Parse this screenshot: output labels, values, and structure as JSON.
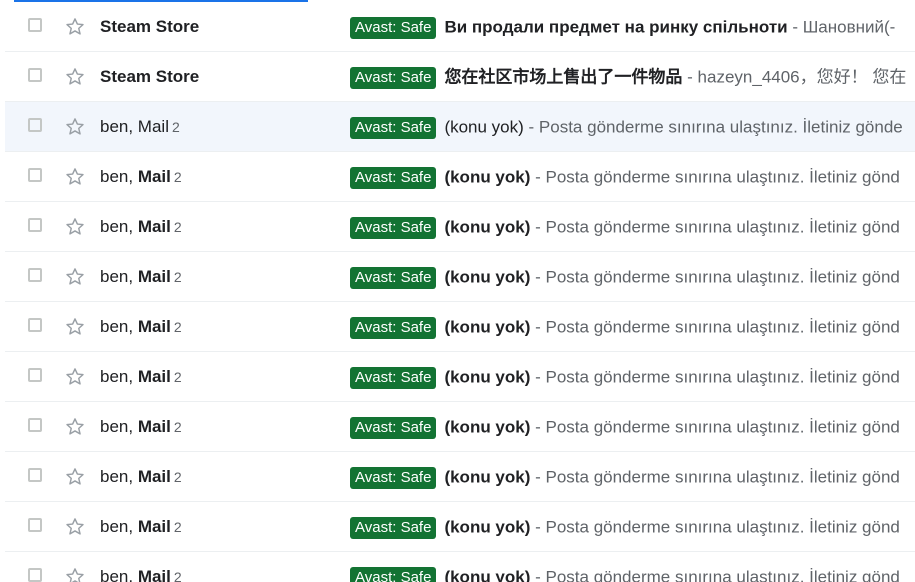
{
  "colors": {
    "badge_bg": "#137333",
    "badge_text": "#ffffff",
    "read_row_bg": "#f2f6fc",
    "accent": "#1a73e8"
  },
  "icons": {
    "checkbox": "checkbox-icon",
    "star": "star-outline-icon"
  },
  "rows": [
    {
      "sender_plain": "",
      "sender_bold": "Steam Store",
      "count": "",
      "badge": "Avast: Safe",
      "subject": "Ви продали предмет на ринку спільноти",
      "snippet": " - Шановний(-",
      "read": false
    },
    {
      "sender_plain": "",
      "sender_bold": "Steam Store",
      "count": "",
      "badge": "Avast: Safe",
      "subject": "您在社区市场上售出了一件物品",
      "snippet": " - hazeyn_4406，您好！ 您在",
      "read": false
    },
    {
      "sender_plain": "ben, Mail",
      "sender_bold": "",
      "count": "2",
      "badge": "Avast: Safe",
      "subject": "(konu yok)",
      "snippet": " - Posta gönderme sınırına ulaştınız. İletiniz gönde",
      "read": true
    },
    {
      "sender_plain": "ben, ",
      "sender_bold": "Mail",
      "count": "2",
      "badge": "Avast: Safe",
      "subject": "(konu yok)",
      "snippet": " - Posta gönderme sınırına ulaştınız. İletiniz gönd",
      "read": false
    },
    {
      "sender_plain": "ben, ",
      "sender_bold": "Mail",
      "count": "2",
      "badge": "Avast: Safe",
      "subject": "(konu yok)",
      "snippet": " - Posta gönderme sınırına ulaştınız. İletiniz gönd",
      "read": false
    },
    {
      "sender_plain": "ben, ",
      "sender_bold": "Mail",
      "count": "2",
      "badge": "Avast: Safe",
      "subject": "(konu yok)",
      "snippet": " - Posta gönderme sınırına ulaştınız. İletiniz gönd",
      "read": false
    },
    {
      "sender_plain": "ben, ",
      "sender_bold": "Mail",
      "count": "2",
      "badge": "Avast: Safe",
      "subject": "(konu yok)",
      "snippet": " - Posta gönderme sınırına ulaştınız. İletiniz gönd",
      "read": false
    },
    {
      "sender_plain": "ben, ",
      "sender_bold": "Mail",
      "count": "2",
      "badge": "Avast: Safe",
      "subject": "(konu yok)",
      "snippet": " - Posta gönderme sınırına ulaştınız. İletiniz gönd",
      "read": false
    },
    {
      "sender_plain": "ben, ",
      "sender_bold": "Mail",
      "count": "2",
      "badge": "Avast: Safe",
      "subject": "(konu yok)",
      "snippet": " - Posta gönderme sınırına ulaştınız. İletiniz gönd",
      "read": false
    },
    {
      "sender_plain": "ben, ",
      "sender_bold": "Mail",
      "count": "2",
      "badge": "Avast: Safe",
      "subject": "(konu yok)",
      "snippet": " - Posta gönderme sınırına ulaştınız. İletiniz gönd",
      "read": false
    },
    {
      "sender_plain": "ben, ",
      "sender_bold": "Mail",
      "count": "2",
      "badge": "Avast: Safe",
      "subject": "(konu yok)",
      "snippet": " - Posta gönderme sınırına ulaştınız. İletiniz gönd",
      "read": false
    },
    {
      "sender_plain": "ben, ",
      "sender_bold": "Mail",
      "count": "2",
      "badge": "Avast: Safe",
      "subject": "(konu yok)",
      "snippet": " - Posta gönderme sınırına ulaştınız. İletiniz gönd",
      "read": false
    }
  ]
}
